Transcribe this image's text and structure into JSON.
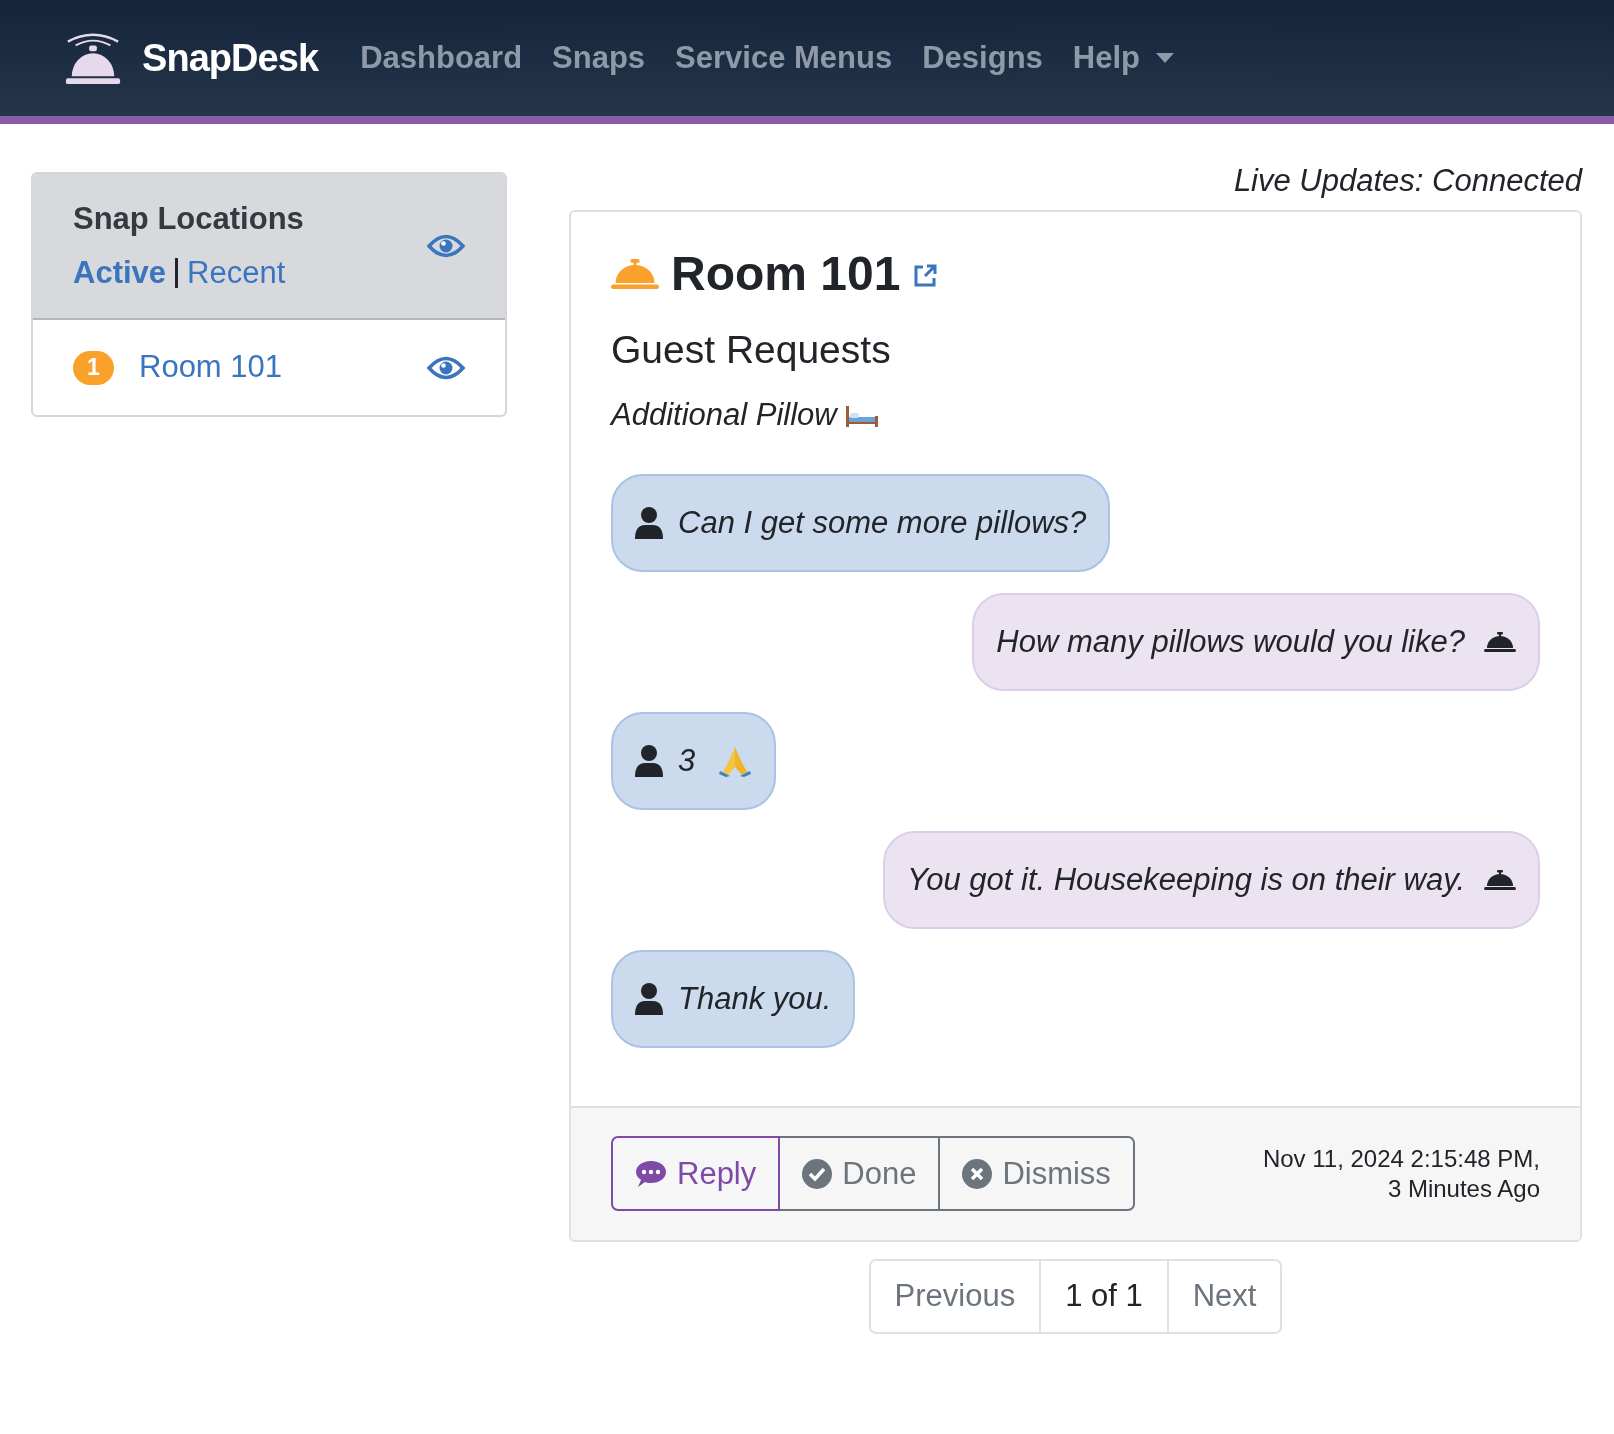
{
  "navbar": {
    "brand": "SnapDesk",
    "items": [
      {
        "label": "Dashboard",
        "kind": "link"
      },
      {
        "label": "Snaps",
        "kind": "link"
      },
      {
        "label": "Service Menus",
        "kind": "link"
      },
      {
        "label": "Designs",
        "kind": "link"
      },
      {
        "label": "Help",
        "kind": "dropdown"
      }
    ]
  },
  "sidebar": {
    "title": "Snap Locations",
    "filters": [
      {
        "label": "Active",
        "selected": true
      },
      {
        "label": "Recent",
        "selected": false
      }
    ],
    "locations": [
      {
        "badge": "1",
        "name": "Room 101"
      }
    ]
  },
  "live_status": "Live Updates: Connected",
  "snap": {
    "room": "Room 101",
    "section": "Guest Requests",
    "request": "Additional Pillow",
    "messages": [
      {
        "kind": "guest",
        "text": "Can I get some more pillows?"
      },
      {
        "kind": "staff",
        "text": "How many pillows would you like?"
      },
      {
        "kind": "guest",
        "text": "3",
        "praying_hands": true
      },
      {
        "kind": "staff",
        "text": "You got it. Housekeeping is on their way."
      },
      {
        "kind": "guest",
        "text": "Thank you."
      }
    ],
    "actions": [
      {
        "label": "Reply",
        "kind": "reply"
      },
      {
        "label": "Done",
        "kind": "done"
      },
      {
        "label": "Dismiss",
        "kind": "dismiss"
      }
    ],
    "timestamp": "Nov 11, 2024 2:15:48 PM,",
    "age": "3 Minutes Ago"
  },
  "pagination": [
    {
      "label": "Previous",
      "disabled": true
    },
    {
      "label": "1 of 1",
      "disabled": false
    },
    {
      "label": "Next",
      "disabled": true
    }
  ]
}
